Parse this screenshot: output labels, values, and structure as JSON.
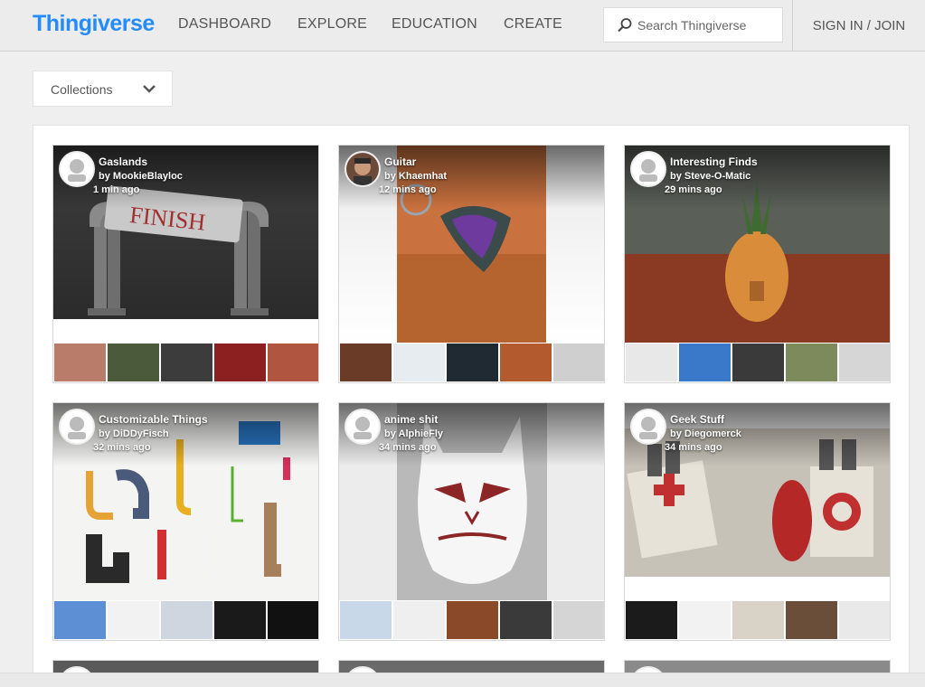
{
  "header": {
    "logo": "Thingiverse",
    "nav": [
      "DASHBOARD",
      "EXPLORE",
      "EDUCATION",
      "CREATE"
    ],
    "search_placeholder": "Search Thingiverse",
    "signin": "SIGN IN / JOIN"
  },
  "collections": {
    "label": "Collections"
  },
  "cards": [
    {
      "title": "Gaslands",
      "author": "MookieBlayloc",
      "time": "1 min ago",
      "avatar": "default-avatar-icon"
    },
    {
      "title": "Guitar",
      "author": "Khaemhat",
      "time": "12 mins ago",
      "avatar": "user-photo"
    },
    {
      "title": "Interesting Finds",
      "author": "Steve-O-Matic",
      "time": "29 mins ago",
      "avatar": "default-avatar-icon"
    },
    {
      "title": "Customizable Things",
      "author": "DiDDyFisch",
      "time": "32 mins ago",
      "avatar": "default-avatar-icon"
    },
    {
      "title": "anime shit",
      "author": "AlphieFly",
      "time": "34 mins ago",
      "avatar": "default-avatar-icon"
    },
    {
      "title": "Geek Stuff",
      "author": "Diegomerck",
      "time": "34 mins ago",
      "avatar": "default-avatar-icon"
    }
  ],
  "by_prefix": "by",
  "colors": {
    "brand": "#248bfb",
    "header_bg": "#ececec",
    "page_bg": "#efefef"
  }
}
